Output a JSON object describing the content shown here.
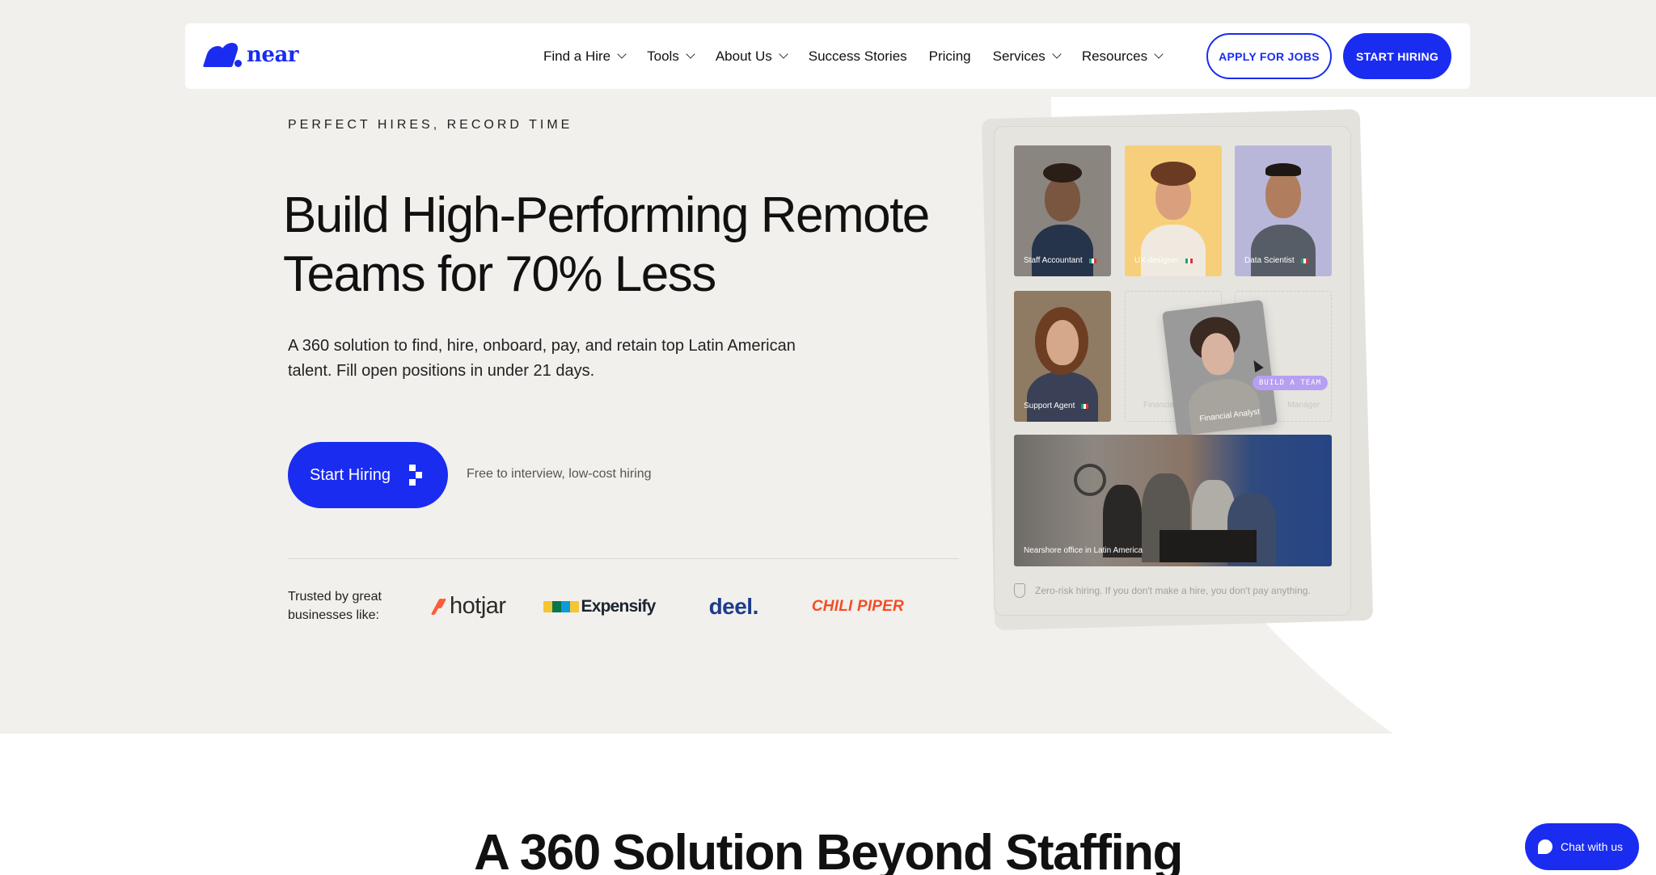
{
  "nav": {
    "logo_text": "near",
    "items": [
      {
        "label": "Find a Hire",
        "has_dropdown": true
      },
      {
        "label": "Tools",
        "has_dropdown": true
      },
      {
        "label": "About Us",
        "has_dropdown": true
      },
      {
        "label": "Success Stories",
        "has_dropdown": false
      },
      {
        "label": "Pricing",
        "has_dropdown": false
      },
      {
        "label": "Services",
        "has_dropdown": true
      },
      {
        "label": "Resources",
        "has_dropdown": true
      }
    ],
    "apply_button": "APPLY FOR JOBS",
    "start_button": "START HIRING"
  },
  "hero": {
    "eyebrow": "PERFECT HIRES, RECORD TIME",
    "headline": "Build High-Performing Remote Teams for 70% Less",
    "subheadline": "A 360 solution to find, hire, onboard, pay, and retain top Latin American talent. Fill open positions in under 21 days.",
    "cta_label": "Start Hiring",
    "cta_note": "Free to interview, low-cost hiring",
    "trusted_label": "Trusted by great businesses like:",
    "brands": [
      "hotjar",
      "Expensify",
      "deel.",
      "CHILI PIPER"
    ]
  },
  "showcase": {
    "cards": [
      {
        "role": "Staff Accountant"
      },
      {
        "role": "UX designer"
      },
      {
        "role": "Data Scientist"
      },
      {
        "role": "Support Agent"
      }
    ],
    "ghost_labels": [
      "Financia",
      "Manager"
    ],
    "floating_card_role": "Financial Analyst",
    "badge": "BUILD A TEAM",
    "office_caption": "Nearshore office in Latin America",
    "zero_risk": "Zero-risk hiring. If you don't make a hire, you don't pay anything."
  },
  "section": {
    "title": "A 360 Solution Beyond Staffing"
  },
  "chat": {
    "label": "Chat with us"
  },
  "colors": {
    "brand_blue": "#1a2cf0",
    "hero_bg": "#f1f0ec"
  }
}
